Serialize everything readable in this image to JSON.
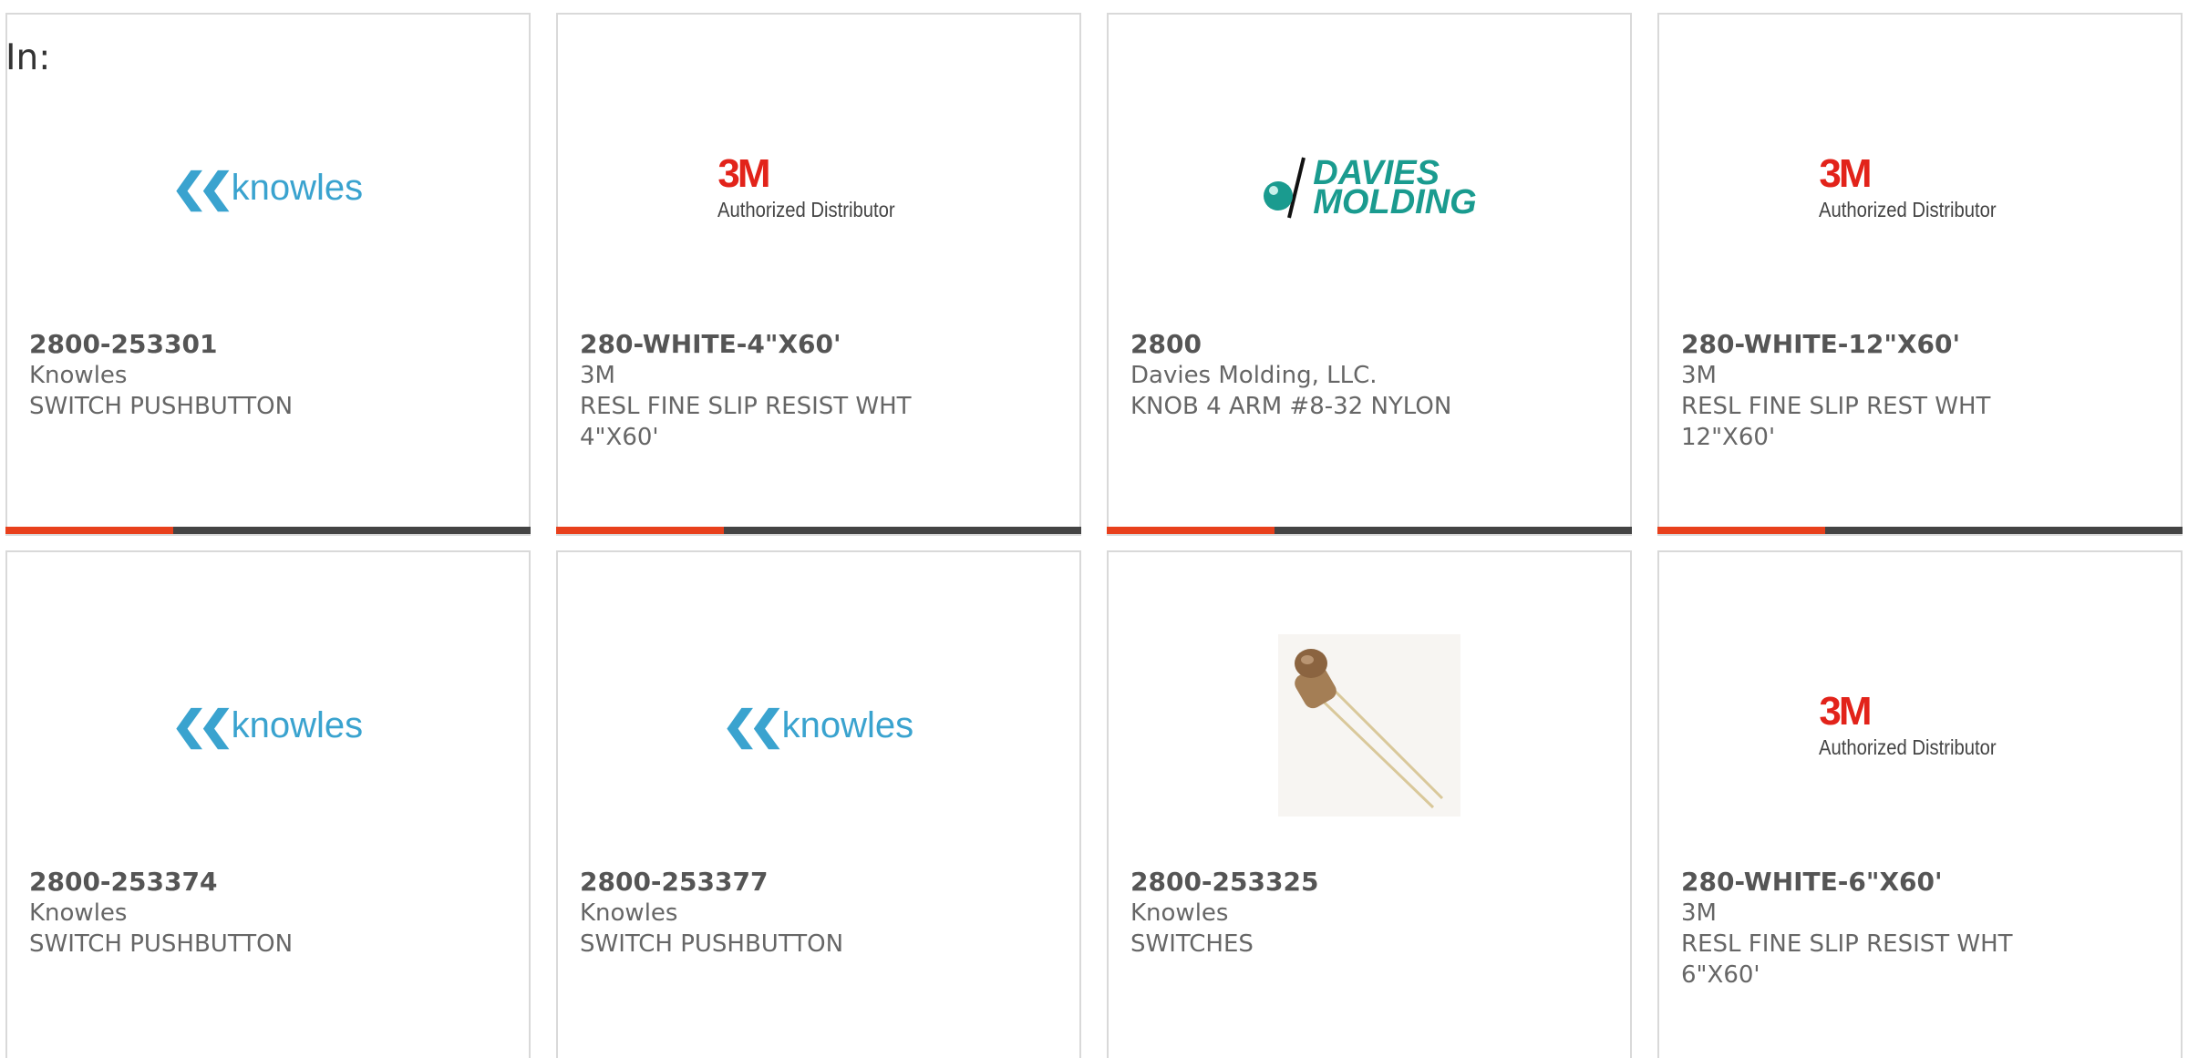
{
  "header": {
    "in_label": "In:"
  },
  "products": [
    {
      "part_number": "2800-253301",
      "manufacturer": "Knowles",
      "description": "SWITCH PUSHBUTTON",
      "logo": "knowles-logo"
    },
    {
      "part_number": "280-WHITE-4\"X60'",
      "manufacturer": "3M",
      "description": "RESL FINE SLIP RESIST WHT 4\"X60'",
      "logo": "3m-authorized-distributor-logo"
    },
    {
      "part_number": "2800",
      "manufacturer": "Davies Molding, LLC.",
      "description": "KNOB 4 ARM #8-32 NYLON",
      "logo": "davies-molding-logo"
    },
    {
      "part_number": "280-WHITE-12\"X60'",
      "manufacturer": "3M",
      "description": "RESL FINE SLIP REST WHT 12\"X60'",
      "logo": "3m-authorized-distributor-logo"
    },
    {
      "part_number": "2800-253374",
      "manufacturer": "Knowles",
      "description": "SWITCH PUSHBUTTON",
      "logo": "knowles-logo"
    },
    {
      "part_number": "2800-253377",
      "manufacturer": "Knowles",
      "description": "SWITCH PUSHBUTTON",
      "logo": "knowles-logo"
    },
    {
      "part_number": "2800-253325",
      "manufacturer": "Knowles",
      "description": "SWITCHES",
      "logo": "switch-component-photo"
    },
    {
      "part_number": "280-WHITE-6\"X60'",
      "manufacturer": "3M",
      "description": "RESL FINE SLIP RESIST WHT 6\"X60'",
      "logo": "3m-authorized-distributor-logo"
    }
  ],
  "logos": {
    "knowles": {
      "text": "knowles",
      "color": "#3aa3cf"
    },
    "threem": {
      "mark": "3M",
      "sub": "Authorized Distributor",
      "color": "#e2231a"
    },
    "davies": {
      "line1": "DAVIES",
      "line2": "MOLDING",
      "color": "#1a9b8f"
    }
  },
  "colors": {
    "accent": "#e8401c",
    "bar": "#444444",
    "border": "#d9d9d9"
  }
}
